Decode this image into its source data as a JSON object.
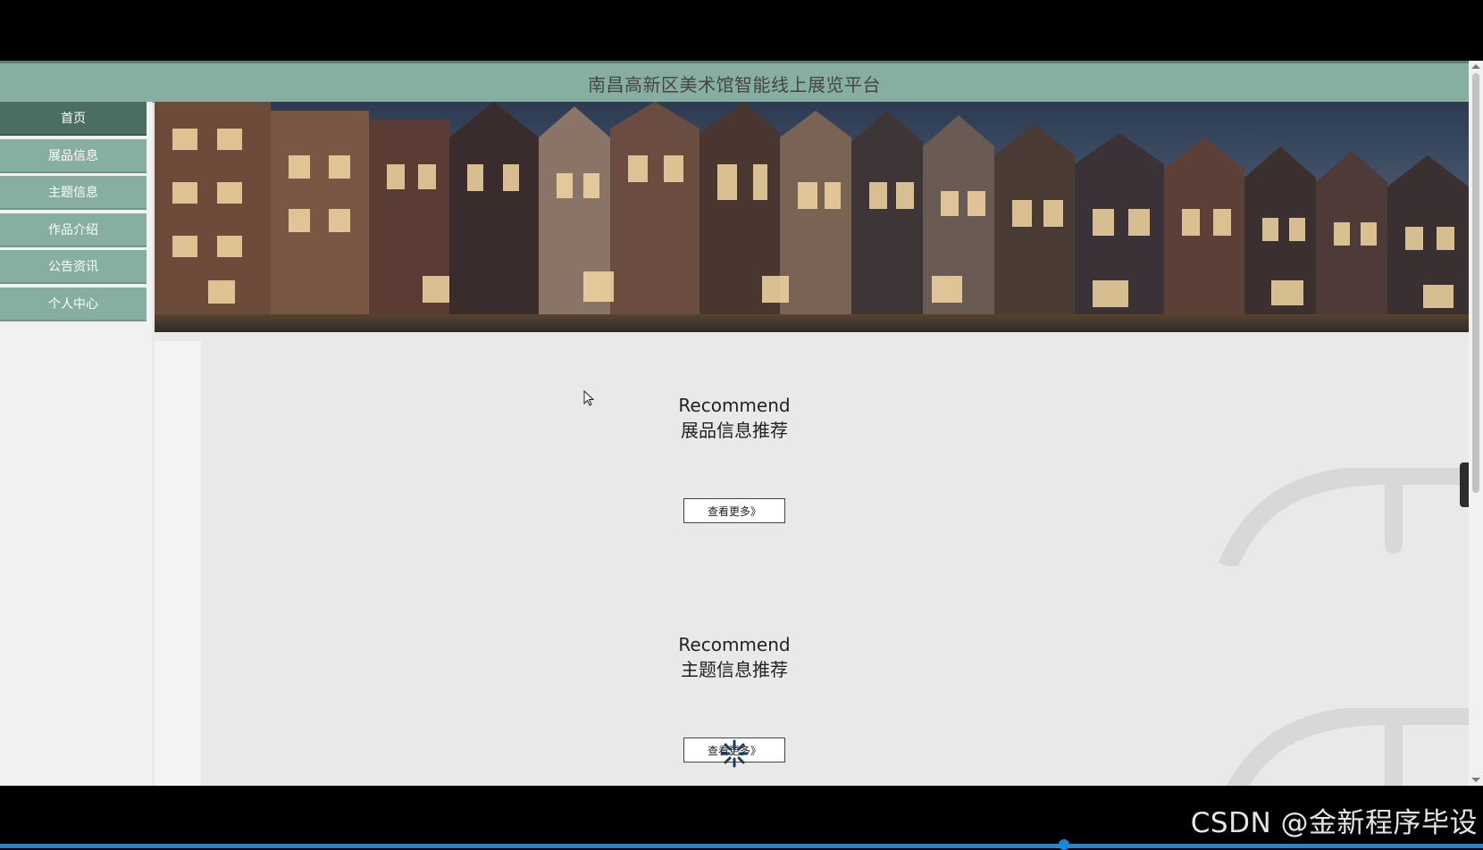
{
  "header": {
    "title": "南昌高新区美术馆智能线上展览平台"
  },
  "sidebar": {
    "items": [
      {
        "label": "首页",
        "active": true
      },
      {
        "label": "展品信息"
      },
      {
        "label": "主题信息"
      },
      {
        "label": "作品介绍"
      },
      {
        "label": "公告资讯"
      },
      {
        "label": "个人中心"
      }
    ]
  },
  "sections": [
    {
      "en": "Recommend",
      "zh": "展品信息推荐",
      "more": "查看更多》"
    },
    {
      "en": "Recommend",
      "zh": "主题信息推荐",
      "more": "查看更多》"
    }
  ],
  "side_toggle": {
    "icon": "chevron-right-icon",
    "glyph": "›"
  },
  "watermark": "CSDN @金新程序毕设",
  "colors": {
    "nav": "#86aea1",
    "nav_active": "#4a6e62",
    "accent": "#1a88d8"
  }
}
